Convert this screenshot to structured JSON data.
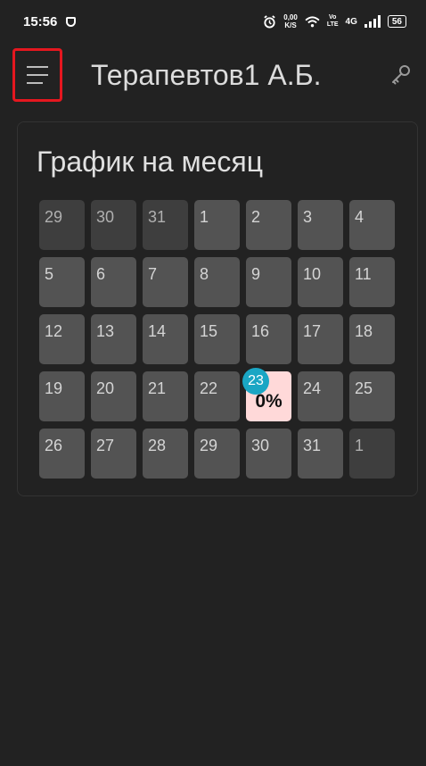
{
  "status_bar": {
    "time": "15:56",
    "net_speed_value": "0,00",
    "net_speed_unit": "K/S",
    "volte_top": "Vo",
    "volte_bottom": "LTE",
    "network": "4G",
    "battery": "56"
  },
  "app_bar": {
    "title": "Терапевтов1 А.Б."
  },
  "schedule": {
    "title": "График на месяц",
    "days": [
      {
        "label": "29",
        "state": "muted"
      },
      {
        "label": "30",
        "state": "muted"
      },
      {
        "label": "31",
        "state": "muted"
      },
      {
        "label": "1",
        "state": "normal"
      },
      {
        "label": "2",
        "state": "normal"
      },
      {
        "label": "3",
        "state": "normal"
      },
      {
        "label": "4",
        "state": "normal"
      },
      {
        "label": "5",
        "state": "normal"
      },
      {
        "label": "6",
        "state": "normal"
      },
      {
        "label": "7",
        "state": "normal"
      },
      {
        "label": "8",
        "state": "normal"
      },
      {
        "label": "9",
        "state": "normal"
      },
      {
        "label": "10",
        "state": "normal"
      },
      {
        "label": "11",
        "state": "normal"
      },
      {
        "label": "12",
        "state": "normal"
      },
      {
        "label": "13",
        "state": "normal"
      },
      {
        "label": "14",
        "state": "normal"
      },
      {
        "label": "15",
        "state": "normal"
      },
      {
        "label": "16",
        "state": "normal"
      },
      {
        "label": "17",
        "state": "normal"
      },
      {
        "label": "18",
        "state": "normal"
      },
      {
        "label": "19",
        "state": "normal"
      },
      {
        "label": "20",
        "state": "normal"
      },
      {
        "label": "21",
        "state": "normal"
      },
      {
        "label": "22",
        "state": "normal"
      },
      {
        "label": "23",
        "state": "today",
        "percent": "0%"
      },
      {
        "label": "24",
        "state": "normal"
      },
      {
        "label": "25",
        "state": "normal"
      },
      {
        "label": "26",
        "state": "normal"
      },
      {
        "label": "27",
        "state": "normal"
      },
      {
        "label": "28",
        "state": "normal"
      },
      {
        "label": "29",
        "state": "normal"
      },
      {
        "label": "30",
        "state": "normal"
      },
      {
        "label": "31",
        "state": "normal"
      },
      {
        "label": "1",
        "state": "muted"
      }
    ]
  },
  "colors": {
    "background": "#222222",
    "day_cell": "#535353",
    "day_cell_muted": "#3e3e3e",
    "today_cell": "#ffd9d9",
    "today_badge": "#1aa6c4",
    "highlight_border": "#e5171f"
  }
}
